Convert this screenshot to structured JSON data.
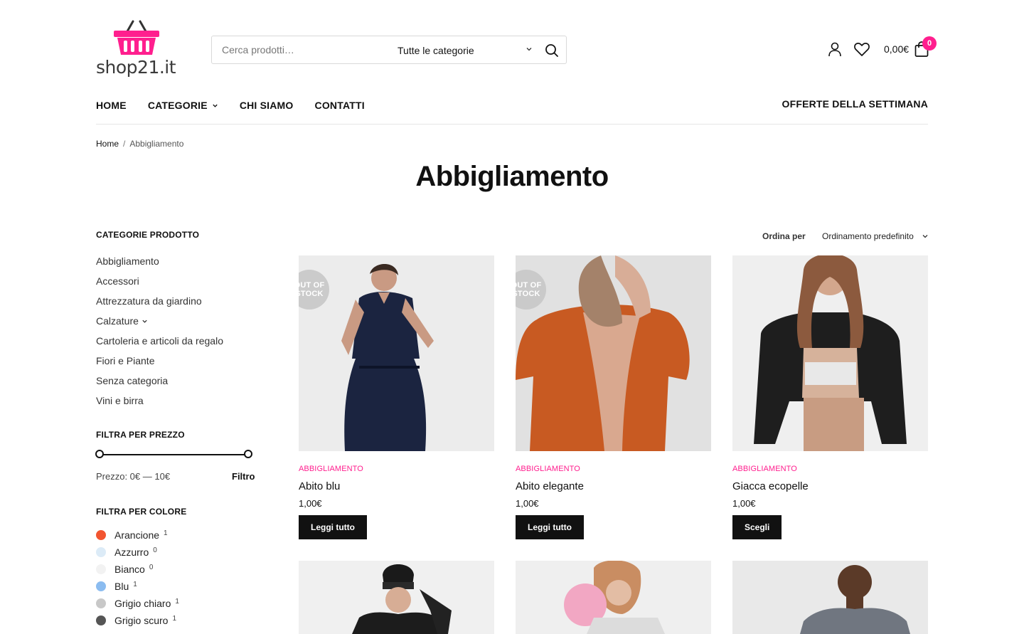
{
  "brand": {
    "logo_text": "shop21.it",
    "accent": "#ff1f8e"
  },
  "search": {
    "placeholder": "Cerca prodotti…",
    "category": "Tutte le categorie"
  },
  "header": {
    "cart_total": "0,00€",
    "cart_count": "0"
  },
  "nav": {
    "items": [
      "HOME",
      "CATEGORIE",
      "CHI SIAMO",
      "CONTATTI"
    ],
    "right": "OFFERTE DELLA SETTIMANA"
  },
  "breadcrumb": {
    "home": "Home",
    "sep": "/",
    "current": "Abbigliamento"
  },
  "page_title": "Abbigliamento",
  "sidebar": {
    "categories_title": "CATEGORIE PRODOTTO",
    "categories": [
      "Abbigliamento",
      "Accessori",
      "Attrezzatura da giardino",
      "Calzature",
      "Cartoleria e articoli da regalo",
      "Fiori e Piante",
      "Senza categoria",
      "Vini e birra"
    ],
    "price_title": "FILTRA PER PREZZO",
    "price_range_text": "Prezzo: 0€ — 10€",
    "price_min": 0,
    "price_max": 10,
    "filter_button": "Filtro",
    "color_title": "FILTRA PER COLORE",
    "colors": [
      {
        "name": "Arancione",
        "count": "1",
        "hex": "#f25530"
      },
      {
        "name": "Azzurro",
        "count": "0",
        "hex": "#dcebf7"
      },
      {
        "name": "Bianco",
        "count": "0",
        "hex": "#f2f2f2"
      },
      {
        "name": "Blu",
        "count": "1",
        "hex": "#8bbcf0"
      },
      {
        "name": "Grigio chiaro",
        "count": "1",
        "hex": "#c8c8c8"
      },
      {
        "name": "Grigio scuro",
        "count": "1",
        "hex": "#555555"
      }
    ]
  },
  "sort": {
    "label": "Ordina per",
    "value": "Ordinamento predefinito"
  },
  "products": [
    {
      "category": "ABBIGLIAMENTO",
      "name": "Abito blu",
      "price": "1,00€",
      "button": "Leggi tutto",
      "badge": "OUT OF STOCK"
    },
    {
      "category": "ABBIGLIAMENTO",
      "name": "Abito elegante",
      "price": "1,00€",
      "button": "Leggi tutto",
      "badge": "OUT OF STOCK"
    },
    {
      "category": "ABBIGLIAMENTO",
      "name": "Giacca ecopelle",
      "price": "1,00€",
      "button": "Scegli",
      "badge": ""
    }
  ]
}
